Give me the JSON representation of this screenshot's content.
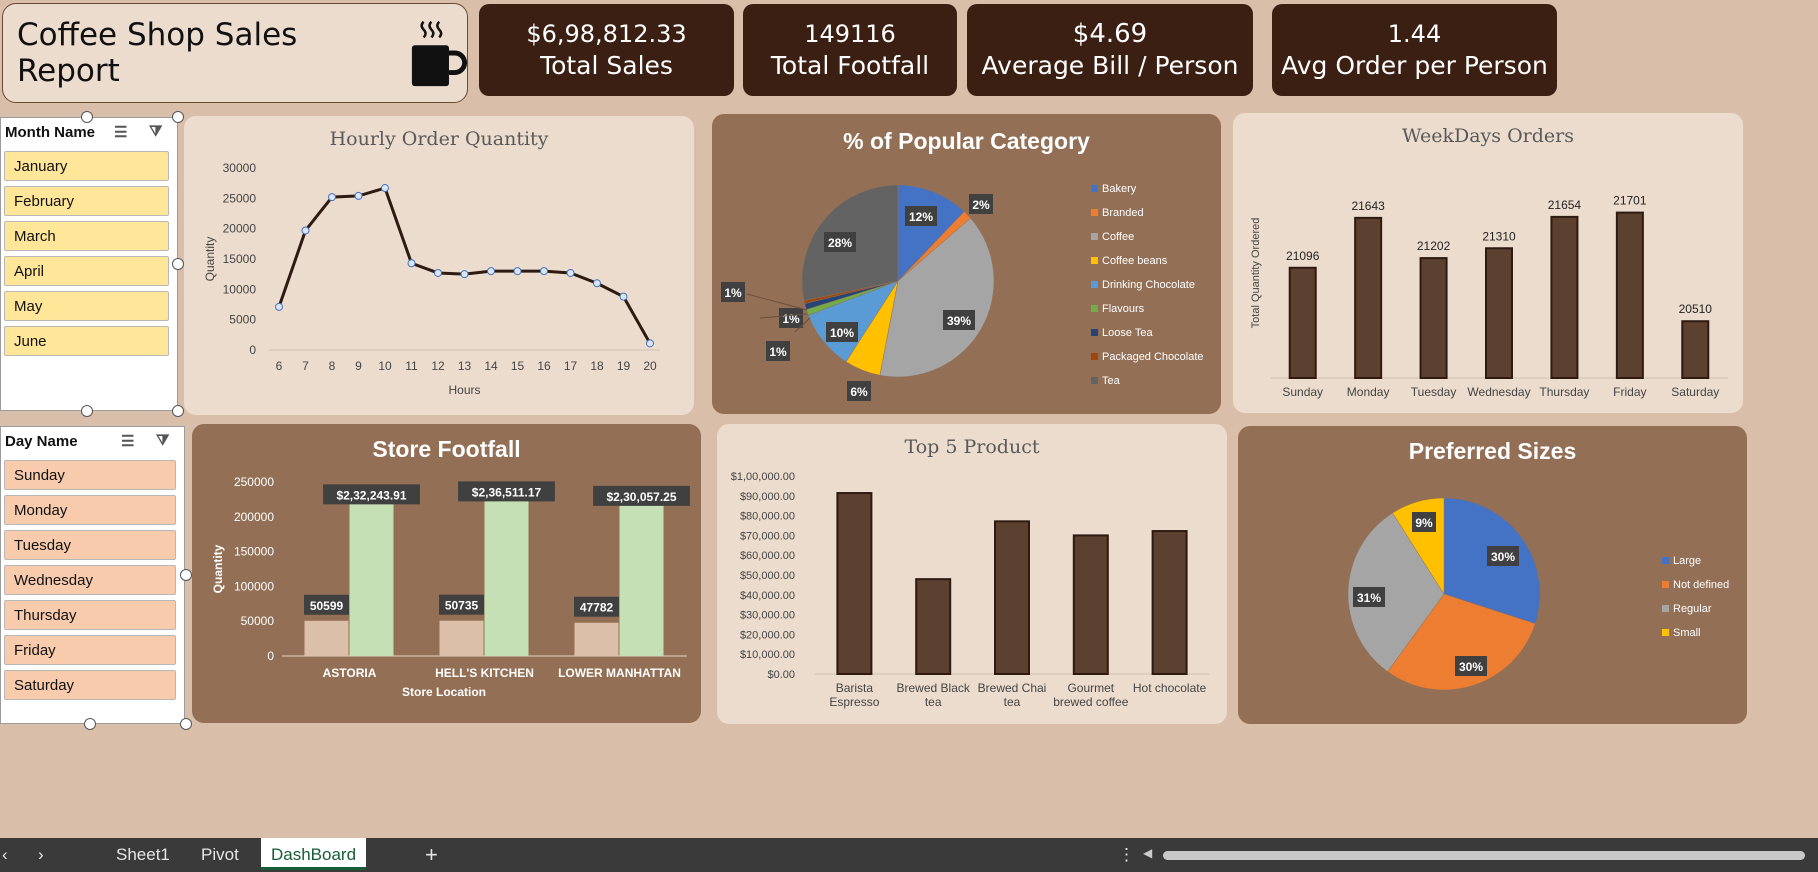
{
  "title": {
    "text": "Coffee Shop Sales Report",
    "icon": "coffee-cup-icon"
  },
  "kpis": [
    {
      "value": "$6,98,812.33",
      "label": "Total Sales"
    },
    {
      "value": "149116",
      "label": "Total Footfall"
    },
    {
      "value": "$4.69",
      "label": "Average Bill / Person"
    },
    {
      "value": "1.44",
      "label": "Avg Order per Person"
    }
  ],
  "slicers": {
    "month": {
      "header": "Month Name",
      "items": [
        "January",
        "February",
        "March",
        "April",
        "May",
        "June"
      ]
    },
    "day": {
      "header": "Day Name",
      "items": [
        "Sunday",
        "Monday",
        "Tuesday",
        "Wednesday",
        "Thursday",
        "Friday",
        "Saturday"
      ]
    }
  },
  "colors": {
    "dark_brown": "#3a1f12",
    "bar_brown": "#5c4030",
    "panel_dark": "#936f55",
    "panel_light": "#ecdccd",
    "background": "#d9bfa9",
    "month_slicer": "#ffe699",
    "day_slicer": "#f8cbad"
  },
  "charts": {
    "hourly": {
      "type": "line",
      "title": "Hourly Order Quantity",
      "xlabel": "Hours",
      "ylabel": "Quantity",
      "x": [
        6,
        7,
        8,
        9,
        10,
        11,
        12,
        13,
        14,
        15,
        16,
        17,
        18,
        19,
        20
      ],
      "values": [
        7100,
        19700,
        25200,
        25400,
        26700,
        14300,
        12700,
        12500,
        13000,
        13000,
        13000,
        12700,
        11000,
        8800,
        1100
      ],
      "ylim": [
        0,
        30000
      ],
      "yticks": [
        0,
        5000,
        10000,
        15000,
        20000,
        25000,
        30000
      ]
    },
    "category": {
      "type": "pie",
      "title": "% of Popular Category",
      "slices": [
        {
          "name": "Bakery",
          "value": 12,
          "label": "12%",
          "color": "#4472c4"
        },
        {
          "name": "Branded",
          "value": 1.5,
          "label": "2%",
          "color": "#ed7d31"
        },
        {
          "name": "Coffee",
          "value": 39,
          "label": "39%",
          "color": "#a5a5a5"
        },
        {
          "name": "Coffee beans",
          "value": 6,
          "label": "6%",
          "color": "#ffc000"
        },
        {
          "name": "Drinking Chocolate",
          "value": 10,
          "label": "10%",
          "color": "#5b9bd5"
        },
        {
          "name": "Flavours",
          "value": 1,
          "label": "1%",
          "color": "#70ad47"
        },
        {
          "name": "Loose Tea",
          "value": 1,
          "label": "1%",
          "color": "#264478"
        },
        {
          "name": "Packaged Chocolate",
          "value": 0.5,
          "label": "1%",
          "color": "#9e480e"
        },
        {
          "name": "Tea",
          "value": 28,
          "label": "28%",
          "color": "#636363"
        }
      ]
    },
    "weekdays": {
      "type": "bar",
      "title": "WeekDays Orders",
      "ylabel": "Total Quantity Ordered",
      "categories": [
        "Sunday",
        "Monday",
        "Tuesday",
        "Wednesday",
        "Thursday",
        "Friday",
        "Saturday"
      ],
      "values": [
        21096,
        21643,
        21202,
        21310,
        21654,
        21701,
        20510
      ]
    },
    "footfall": {
      "type": "bar",
      "title": "Store Footfall",
      "xlabel": "Store Location",
      "ylabel": "Quantity",
      "categories": [
        "ASTORIA",
        "HELL'S KITCHEN",
        "LOWER MANHATTAN"
      ],
      "series": [
        {
          "values": [
            50599,
            50735,
            47782
          ],
          "labels": [
            "50599",
            "50735",
            "47782"
          ],
          "color": "#dcbfa8"
        },
        {
          "values": [
            232243.91,
            236511.17,
            230057.25
          ],
          "labels": [
            "$2,32,243.91",
            "$2,36,511.17",
            "$2,30,057.25"
          ],
          "color": "#c5e0b4"
        }
      ],
      "ylim": [
        0,
        250000
      ],
      "yticks": [
        0,
        50000,
        100000,
        150000,
        200000,
        250000
      ]
    },
    "top5": {
      "type": "bar",
      "title": "Top 5 Product",
      "categories": [
        [
          "Barista",
          "Espresso"
        ],
        [
          "Brewed Black",
          "tea"
        ],
        [
          "Brewed Chai",
          "tea"
        ],
        [
          "Gourmet",
          "brewed coffee"
        ],
        [
          "Hot chocolate"
        ]
      ],
      "values": [
        91400,
        47900,
        77100,
        70000,
        72200
      ],
      "ylim": [
        0,
        100000
      ],
      "yticks": [
        "$0.00",
        "$10,000.00",
        "$20,000.00",
        "$30,000.00",
        "$40,000.00",
        "$50,000.00",
        "$60,000.00",
        "$70,000.00",
        "$80,000.00",
        "$90,000.00",
        "$1,00,000.00"
      ]
    },
    "sizes": {
      "type": "pie",
      "title": "Preferred Sizes",
      "slices": [
        {
          "name": "Large",
          "value": 30,
          "label": "30%",
          "color": "#4472c4"
        },
        {
          "name": "Not defined",
          "value": 30,
          "label": "30%",
          "color": "#ed7d31"
        },
        {
          "name": "Regular",
          "value": 31,
          "label": "31%",
          "color": "#a5a5a5"
        },
        {
          "name": "Small",
          "value": 9,
          "label": "9%",
          "color": "#ffc000"
        }
      ]
    }
  },
  "tabs": {
    "items": [
      "Sheet1",
      "Pivot",
      "DashBoard"
    ],
    "active": "DashBoard",
    "add": "+"
  }
}
